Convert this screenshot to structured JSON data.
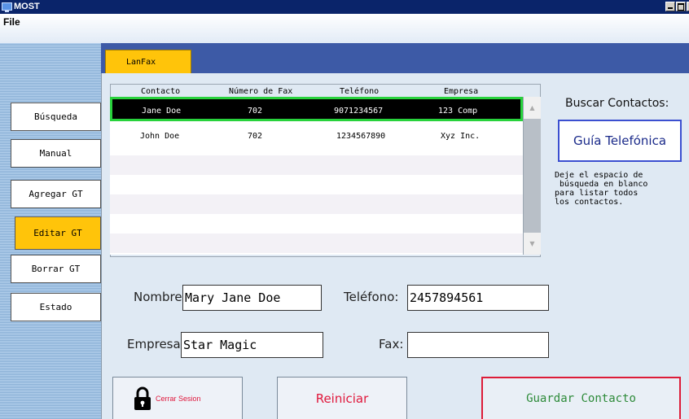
{
  "window": {
    "title": "MOST"
  },
  "menu": {
    "file": "File"
  },
  "sidebar": {
    "items": [
      {
        "label": "Búsqueda"
      },
      {
        "label": "Manual"
      },
      {
        "label": "Agregar GT"
      },
      {
        "label": "Editar GT",
        "active": true
      },
      {
        "label": "Borrar GT"
      },
      {
        "label": "Estado"
      }
    ]
  },
  "tabs": [
    {
      "label": "LanFax",
      "active": true
    }
  ],
  "table": {
    "headers": [
      "Contacto",
      "Número de Fax",
      "Teléfono",
      "Empresa"
    ],
    "rows": [
      {
        "contacto": "Jane Doe",
        "fax": "702",
        "telefono": "9071234567",
        "empresa": "123 Comp",
        "selected": true
      },
      {
        "contacto": "John Doe",
        "fax": "702",
        "telefono": "1234567890",
        "empresa": "Xyz Inc."
      }
    ]
  },
  "search": {
    "title": "Buscar Contactos:",
    "guia_label": "Guía Telefónica",
    "hint": "Deje el espacio de\n búsqueda en blanco\npara listar todos\nlos contactos."
  },
  "form": {
    "nombre_label": "Nombre:",
    "nombre_value": "Mary Jane Doe",
    "telefono_label": "Teléfono:",
    "telefono_value": "2457894561",
    "empresa_label": "Empresa:",
    "empresa_value": "Star Magic",
    "fax_label": "Fax:",
    "fax_value": ""
  },
  "actions": {
    "cerrar_sesion": "Cerrar Sesion",
    "reiniciar": "Reiniciar",
    "guardar": "Guardar Contacto"
  },
  "colors": {
    "title_bar": "#0a246a",
    "tab_strip": "#3d5aa6",
    "active_accent": "#ffc40a",
    "selection_border": "#28d23c",
    "danger": "#e0183c",
    "save_text": "#2e8b3a"
  },
  "icons": [
    "app-icon",
    "minimize-icon",
    "maximize-icon",
    "close-icon",
    "lock-icon",
    "scroll-up-icon",
    "scroll-down-icon"
  ]
}
